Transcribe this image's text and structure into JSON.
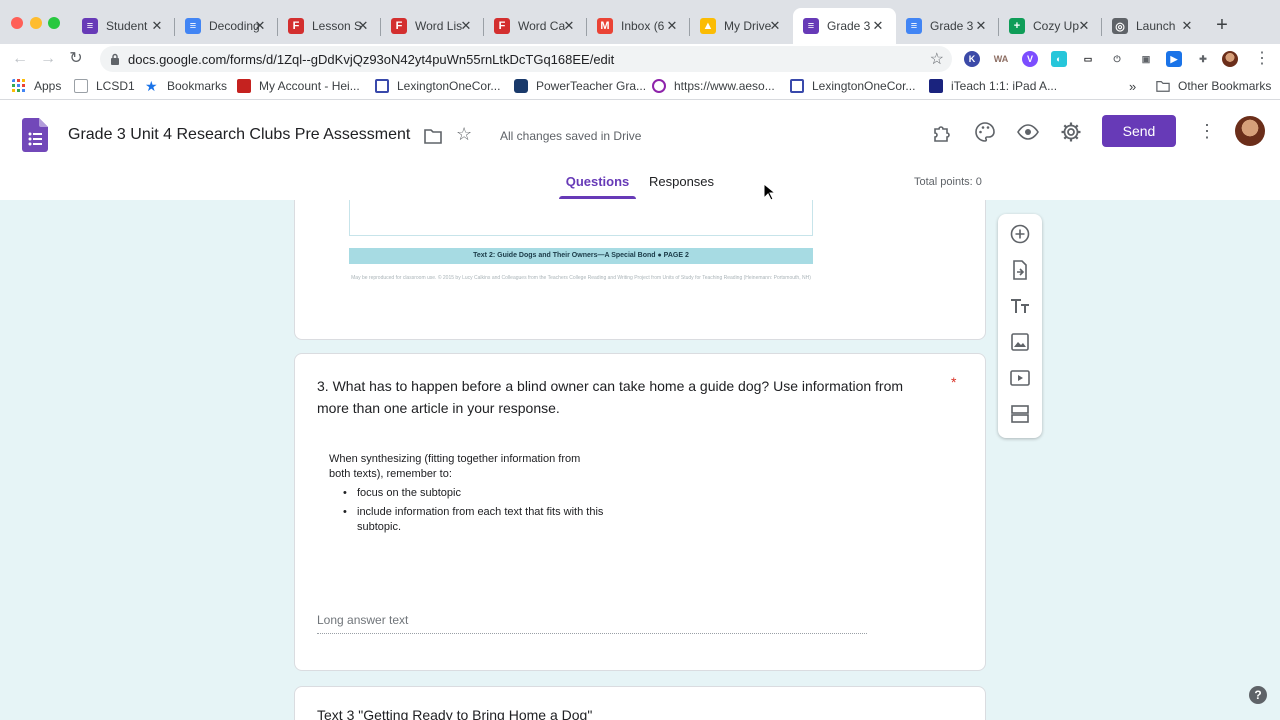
{
  "browser": {
    "tabs": [
      {
        "title": "Student",
        "favicon_color": "#673ab7",
        "favicon_glyph": "≡"
      },
      {
        "title": "Decoding",
        "favicon_color": "#4285f4",
        "favicon_glyph": "≡"
      },
      {
        "title": "Lesson S",
        "favicon_color": "#d32f2f",
        "favicon_glyph": "F"
      },
      {
        "title": "Word Lis",
        "favicon_color": "#d32f2f",
        "favicon_glyph": "F"
      },
      {
        "title": "Word Ca",
        "favicon_color": "#d32f2f",
        "favicon_glyph": "F"
      },
      {
        "title": "Inbox (6",
        "favicon_color": "#ea4335",
        "favicon_glyph": "M"
      },
      {
        "title": "My Drive",
        "favicon_color": "#fbbc04",
        "favicon_glyph": "▲"
      },
      {
        "title": "Grade 3",
        "favicon_color": "#673ab7",
        "favicon_glyph": "≡"
      },
      {
        "title": "Grade 3",
        "favicon_color": "#4285f4",
        "favicon_glyph": "≡"
      },
      {
        "title": "Cozy Up",
        "favicon_color": "#0f9d58",
        "favicon_glyph": "+"
      },
      {
        "title": "Launch",
        "favicon_color": "#5f6368",
        "favicon_glyph": "◎"
      }
    ],
    "active_tab_index": 7,
    "url": "docs.google.com/forms/d/1Zql--gDdKvjQz93oN42yt4puWn55rnLtkDcTGq168EE/edit",
    "bookmarks": [
      {
        "label": "Apps",
        "icon_color": "#4285f4"
      },
      {
        "label": "LCSD1",
        "icon_color": "#9aa0a6"
      },
      {
        "label": "Bookmarks",
        "icon_color": "#1a73e8"
      },
      {
        "label": "My Account - Hei...",
        "icon_color": "#c5221f"
      },
      {
        "label": "LexingtonOneCor...",
        "icon_color": "#3949ab"
      },
      {
        "label": "PowerTeacher Gra...",
        "icon_color": "#1a3a6b"
      },
      {
        "label": "https://www.aeso...",
        "icon_color": "#8e24aa"
      },
      {
        "label": "LexingtonOneCor...",
        "icon_color": "#3949ab"
      },
      {
        "label": "iTeach 1:1: iPad A...",
        "icon_color": "#1a237e"
      }
    ],
    "overflow_label": "»",
    "other_bookmarks": "Other Bookmarks"
  },
  "form_header": {
    "title": "Grade 3 Unit 4 Research Clubs Pre Assessment",
    "save_status": "All changes saved in Drive",
    "send_label": "Send",
    "tab_questions": "Questions",
    "tab_responses": "Responses",
    "total_points": "Total points: 0",
    "accent_color": "#673ab7"
  },
  "content": {
    "image_banner_text": "Text 2: Guide Dogs and Their Owners—A Special Bond  ●  PAGE 2",
    "image_credit_text": "May be reproduced for classroom use. © 2015 by Lucy Calkins and Colleagues from the Teachers College Reading and Writing Project from Units of Study for Teaching Reading (Heinemann: Portsmouth, NH)",
    "question": {
      "number_and_text": "3. What has to happen before a blind owner can take home a guide dog? Use information from more than one article in your response.",
      "required_mark": "*",
      "image_lead": "When synthesizing (fitting together information from both texts), remember to:",
      "image_bullets": [
        "focus on the subtopic",
        "include information from each text that fits with this subtopic."
      ],
      "answer_placeholder": "Long answer text"
    },
    "next_section_title": "Text 3 \"Getting Ready to Bring Home a Dog\""
  },
  "side_toolbar": [
    "add-question-icon",
    "import-questions-icon",
    "add-title-icon",
    "add-image-icon",
    "add-video-icon",
    "add-section-icon"
  ]
}
